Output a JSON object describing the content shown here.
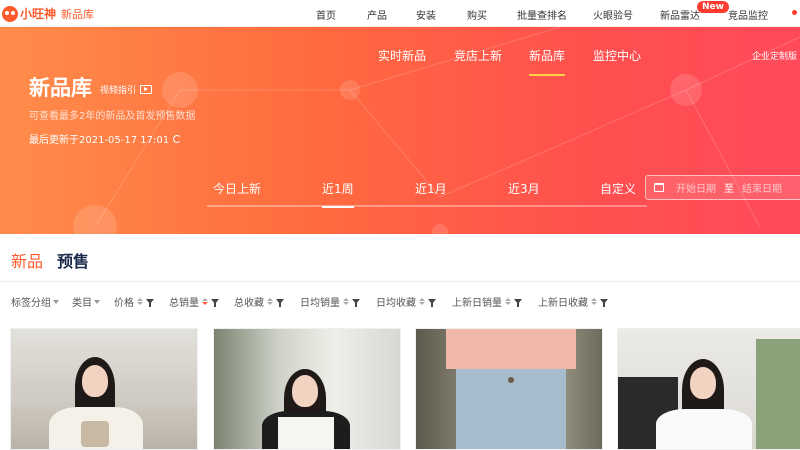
{
  "topnav": {
    "brand": "小旺神",
    "brand_sub": "新品库",
    "links": [
      "首页",
      "产品",
      "安装",
      "购买",
      "批量查排名",
      "火眼验号",
      "新品雷达",
      "竞品监控"
    ],
    "new_badge": "New"
  },
  "hero": {
    "title": "新品库",
    "guide": "视频指引",
    "description": "可查看最多2年的新品及首发预售数据",
    "updated": "最后更新于2021-05-17 17:01",
    "tabs": [
      "实时新品",
      "竞店上新",
      "新品库",
      "监控中心"
    ],
    "active_tab": "新品库",
    "enterprise": "企业定制版",
    "periods": [
      "今日上新",
      "近1周",
      "近1月",
      "近3月",
      "自定义"
    ],
    "active_period": "近1周",
    "date_range": {
      "start_placeholder": "开始日期",
      "separator": "至",
      "end_placeholder": "结束日期"
    }
  },
  "section_tabs": [
    "新品",
    "预售"
  ],
  "filters": [
    {
      "label": "标签分组",
      "kind": "dropdown"
    },
    {
      "label": "类目",
      "kind": "dropdown"
    },
    {
      "label": "价格",
      "kind": "sort-filter"
    },
    {
      "label": "总销量",
      "kind": "sort-filter",
      "sort": "desc"
    },
    {
      "label": "总收藏",
      "kind": "sort-filter"
    },
    {
      "label": "日均销量",
      "kind": "sort-filter"
    },
    {
      "label": "日均收藏",
      "kind": "sort-filter"
    },
    {
      "label": "上新日销量",
      "kind": "sort-filter"
    },
    {
      "label": "上新日收藏",
      "kind": "sort-filter"
    }
  ],
  "colors": {
    "accent": "#ff5a2e",
    "hero_start": "#ff8c4a",
    "hero_end": "#ff4a5a",
    "new_badge": "#ff3b30"
  }
}
